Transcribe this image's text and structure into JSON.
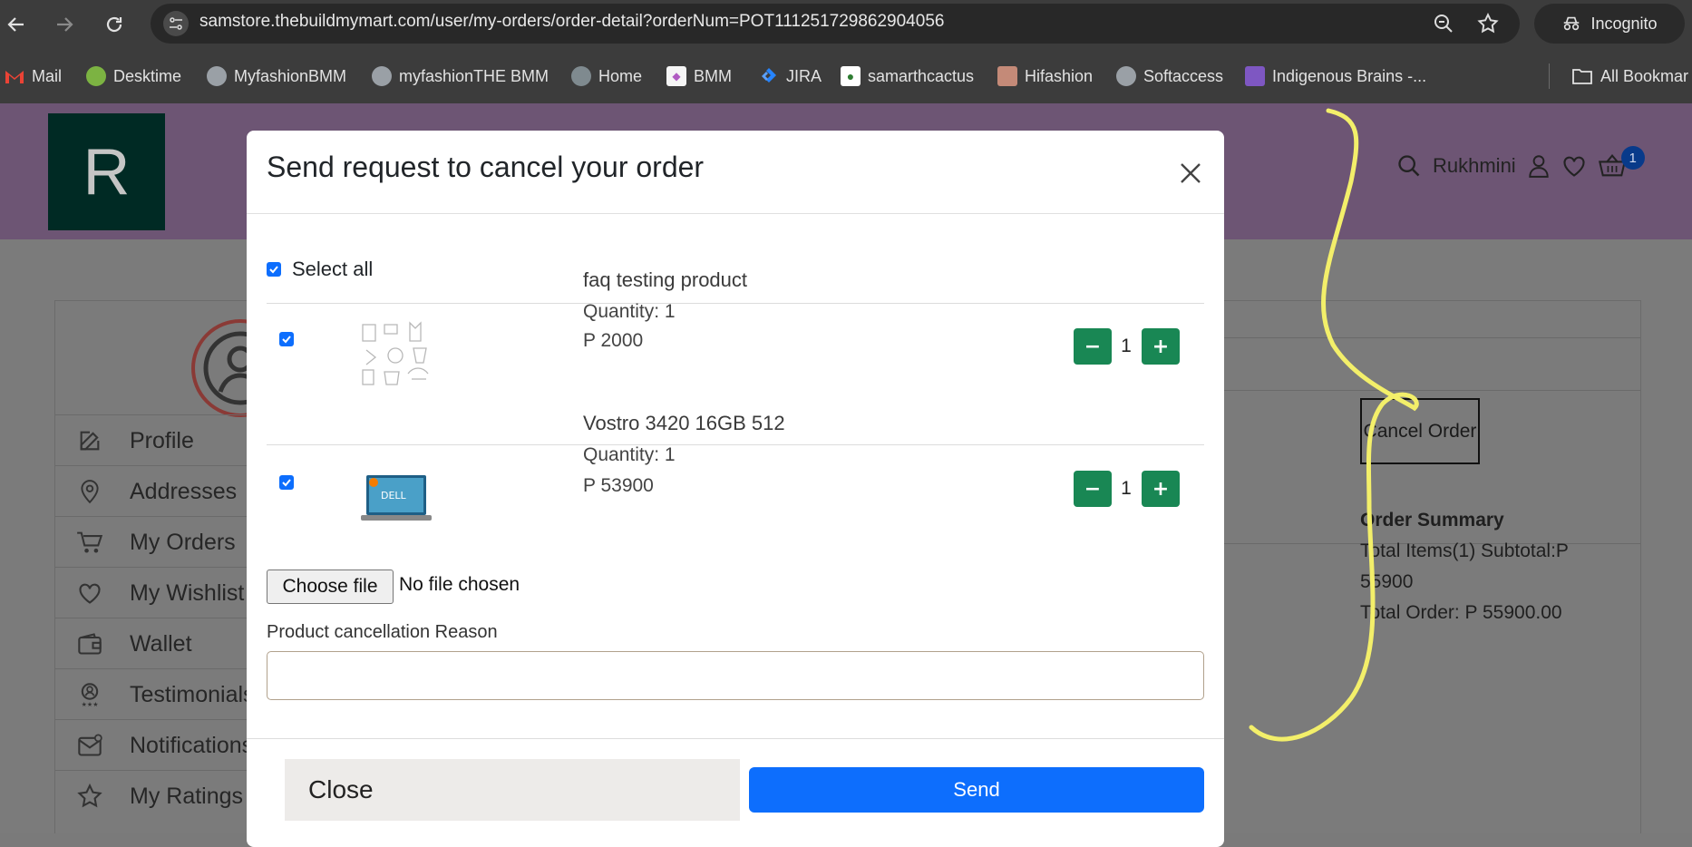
{
  "browser": {
    "url": "samstore.thebuildmymart.com/user/my-orders/order-detail?orderNum=POT111251729862904056",
    "incognito_label": "Incognito",
    "bookmarks": [
      {
        "label": "Mail",
        "icon": "gmail-icon",
        "color": "#ea4335"
      },
      {
        "label": "Desktime",
        "icon": "desktime-icon",
        "color": "#7cb342"
      },
      {
        "label": "MyfashionBMM",
        "icon": "globe-icon",
        "color": "#9aa0a6"
      },
      {
        "label": "myfashionTHE BMM",
        "icon": "globe-icon",
        "color": "#9aa0a6"
      },
      {
        "label": "Home",
        "icon": "globe-icon",
        "color": "#7f8a8f"
      },
      {
        "label": "BMM",
        "icon": "bmm-icon",
        "color": "#b05bc2"
      },
      {
        "label": "JIRA",
        "icon": "jira-icon",
        "color": "#2684ff"
      },
      {
        "label": "samarthcactus",
        "icon": "cactus-icon",
        "color": "#2e7d32"
      },
      {
        "label": "Hifashion",
        "icon": "hifashion-icon",
        "color": "#c48a78"
      },
      {
        "label": "Softaccess",
        "icon": "globe-icon",
        "color": "#9aa0a6"
      },
      {
        "label": "Indigenous Brains -...",
        "icon": "indigenous-icon",
        "color": "#7e57c2"
      }
    ],
    "all_bookmarks_label": "All Bookmar"
  },
  "site": {
    "logo_letter": "R",
    "user_name": "Rukhmini",
    "cart_count": "1",
    "sidebar": [
      {
        "label": "Profile",
        "icon": "edit-icon"
      },
      {
        "label": "Addresses",
        "icon": "location-icon"
      },
      {
        "label": "My Orders",
        "icon": "cart-icon"
      },
      {
        "label": "My Wishlist",
        "icon": "heart-icon"
      },
      {
        "label": "Wallet",
        "icon": "wallet-icon"
      },
      {
        "label": "Testimonials",
        "icon": "testimonial-icon"
      },
      {
        "label": "Notifications",
        "icon": "mail-icon"
      },
      {
        "label": "My Ratings",
        "icon": "star-icon"
      }
    ],
    "cancel_order_label": "Cancel Order",
    "order_summary": {
      "title": "Order Summary",
      "items_line": "Total Items(1) Subtotal:P 55900",
      "total_line": "Total Order: P 55900.00"
    }
  },
  "modal": {
    "title": "Send request to cancel your order",
    "select_all_label": "Select all",
    "products": [
      {
        "name": "faq testing product",
        "quantity_text": "Quantity: 1",
        "price_text": "P 2000",
        "qty": "1"
      },
      {
        "name": "Vostro 3420 16GB 512",
        "quantity_text": "Quantity: 1",
        "price_text": "P 53900",
        "qty": "1"
      }
    ],
    "choose_file_label": "Choose file",
    "file_status": "No file chosen",
    "reason_label": "Product cancellation Reason",
    "reason_value": "",
    "close_label": "Close",
    "send_label": "Send"
  },
  "colors": {
    "primary": "#0d6efd",
    "qty_button": "#198754",
    "header_bg": "#6d5574",
    "scribble": "#f3ef6a"
  }
}
